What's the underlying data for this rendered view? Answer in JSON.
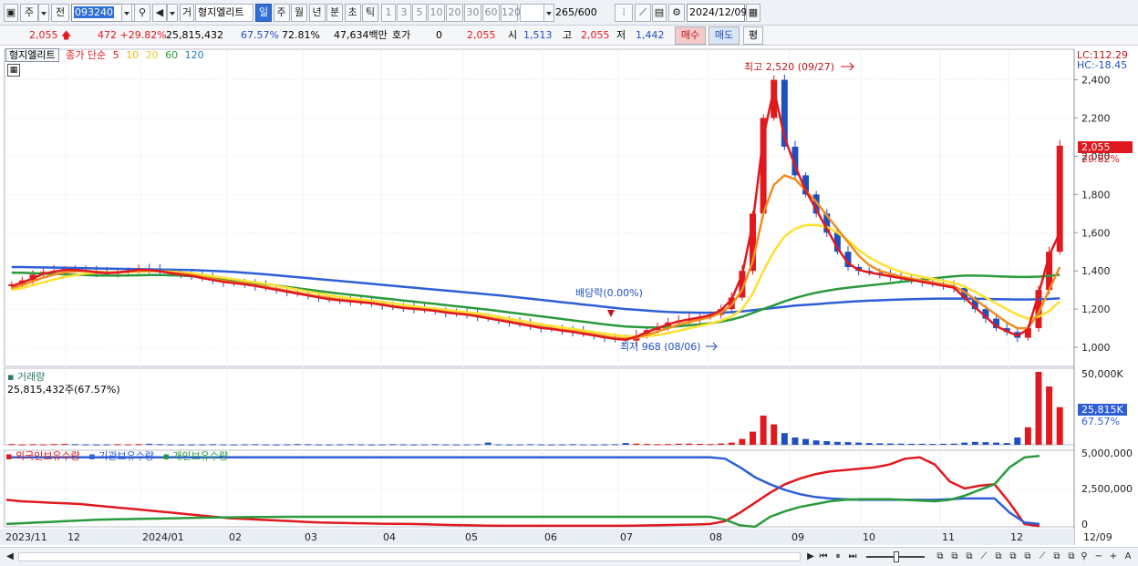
{
  "toolbar": {
    "period_label": "주",
    "prev_label": "전",
    "code": "093240",
    "name_button": "거",
    "stock_name": "형지엘리트",
    "period_tabs": [
      "일",
      "주",
      "월",
      "년",
      "분",
      "초",
      "틱"
    ],
    "active_tab": "일",
    "intervals": [
      "1",
      "3",
      "5",
      "10",
      "20",
      "30",
      "60",
      "120"
    ],
    "count": "265",
    "count_max": "/600",
    "date": "2024/12/09"
  },
  "quote": {
    "price": "2,055",
    "change": "472",
    "change_pct": "+29.82%",
    "volume": "25,815,432",
    "vol_ratio": "67.57%",
    "ratio2": "72.81%",
    "amount": "47,634백만",
    "hoga_label": "호가",
    "hoga_value": "0",
    "hoga_price": "2,055",
    "open_label": "시",
    "open": "1,513",
    "high_label": "고",
    "high": "2,055",
    "low_label": "저",
    "low": "1,442",
    "buy_label": "매수",
    "sell_label": "매도",
    "eval_label": "평"
  },
  "legend": {
    "name": "형지엘리트",
    "ma_label": "종가 단순",
    "ma_periods": [
      "5",
      "10",
      "20",
      "60",
      "120"
    ],
    "volume_label": "거래량",
    "volume_value": "25,815,432주(67.57%)",
    "holdings_labels": [
      "외국인보유수량",
      "기관보유수량",
      "개인보유수량"
    ]
  },
  "colors": {
    "up": "#e0191f",
    "down": "#1f4fbf",
    "ma5": "#e0191f",
    "ma10": "#f08c1e",
    "ma20": "#ffe030",
    "ma60": "#2a9a3c",
    "ma120": "#2f5fd6",
    "foreign": "#e0191f",
    "institution": "#2f5fd6",
    "individual": "#2a9a3c"
  },
  "chart_data": [
    {
      "type": "candlestick",
      "title": "형지엘리트",
      "ylim": [
        900,
        2560
      ],
      "yticks": [
        "1,000",
        "1,200",
        "1,400",
        "1,600",
        "1,800",
        "2,000",
        "2,200",
        "2,400"
      ],
      "xticks": [
        "2023/11",
        "12",
        "2024/01",
        "02",
        "03",
        "04",
        "05",
        "06",
        "07",
        "08",
        "09",
        "10",
        "11",
        "12",
        "12/09"
      ],
      "annotations": {
        "high": "최고 2,520 (09/27)",
        "low": "최저 968 (08/06)",
        "dividend": "배당락(0.00%)",
        "lc": "LC:112.29",
        "hc": "HC:-18.45",
        "last_price": "2,055",
        "last_pct": "29.82%"
      },
      "close": [
        1330,
        1350,
        1380,
        1395,
        1400,
        1410,
        1405,
        1400,
        1390,
        1385,
        1395,
        1400,
        1410,
        1405,
        1395,
        1385,
        1380,
        1375,
        1360,
        1350,
        1340,
        1335,
        1330,
        1320,
        1310,
        1300,
        1290,
        1280,
        1270,
        1260,
        1250,
        1245,
        1240,
        1235,
        1230,
        1220,
        1210,
        1205,
        1200,
        1195,
        1190,
        1180,
        1175,
        1170,
        1160,
        1150,
        1140,
        1130,
        1120,
        1110,
        1100,
        1095,
        1085,
        1080,
        1070,
        1060,
        1050,
        1040,
        1035,
        1060,
        1090,
        1110,
        1130,
        1140,
        1150,
        1160,
        1170,
        1200,
        1260,
        1400,
        1700,
        2200,
        2400,
        2050,
        1900,
        1800,
        1700,
        1600,
        1500,
        1420,
        1400,
        1390,
        1380,
        1370,
        1360,
        1350,
        1340,
        1330,
        1320,
        1310,
        1250,
        1200,
        1150,
        1100,
        1080,
        1050,
        1100,
        1300,
        1500,
        2055
      ],
      "ma": {
        "5": [
          1320,
          1340,
          1360,
          1385,
          1395,
          1405,
          1405,
          1400,
          1392,
          1388,
          1392,
          1398,
          1405,
          1404,
          1398,
          1388,
          1380,
          1374,
          1362,
          1352,
          1342,
          1336,
          1330,
          1321,
          1311,
          1301,
          1291,
          1281,
          1271,
          1261,
          1252,
          1246,
          1241,
          1236,
          1231,
          1222,
          1213,
          1206,
          1201,
          1196,
          1191,
          1182,
          1176,
          1171,
          1162,
          1152,
          1142,
          1132,
          1122,
          1112,
          1102,
          1096,
          1087,
          1081,
          1071,
          1062,
          1052,
          1044,
          1040,
          1055,
          1080,
          1100,
          1120,
          1135,
          1146,
          1156,
          1168,
          1195,
          1250,
          1380,
          1650,
          2100,
          2350,
          2100,
          1950,
          1820,
          1720,
          1620,
          1520,
          1440,
          1405,
          1392,
          1382,
          1372,
          1362,
          1352,
          1342,
          1332,
          1322,
          1312,
          1260,
          1210,
          1160,
          1110,
          1085,
          1060,
          1095,
          1280,
          1480,
          1600
        ],
        "10": [
          1310,
          1325,
          1345,
          1365,
          1380,
          1392,
          1398,
          1400,
          1396,
          1392,
          1392,
          1395,
          1400,
          1401,
          1398,
          1392,
          1385,
          1378,
          1368,
          1358,
          1348,
          1340,
          1334,
          1325,
          1316,
          1306,
          1296,
          1286,
          1276,
          1266,
          1258,
          1250,
          1244,
          1238,
          1232,
          1225,
          1216,
          1209,
          1203,
          1198,
          1192,
          1185,
          1178,
          1172,
          1165,
          1156,
          1146,
          1136,
          1126,
          1116,
          1107,
          1099,
          1091,
          1084,
          1076,
          1067,
          1058,
          1050,
          1045,
          1050,
          1065,
          1082,
          1100,
          1118,
          1132,
          1145,
          1158,
          1180,
          1220,
          1300,
          1450,
          1700,
          1850,
          1900,
          1880,
          1820,
          1760,
          1690,
          1620,
          1550,
          1480,
          1430,
          1400,
          1385,
          1370,
          1360,
          1350,
          1340,
          1330,
          1320,
          1290,
          1250,
          1210,
          1170,
          1130,
          1100,
          1100,
          1180,
          1300,
          1420
        ],
        "20": [
          1300,
          1310,
          1325,
          1340,
          1355,
          1368,
          1378,
          1386,
          1390,
          1392,
          1393,
          1394,
          1396,
          1398,
          1398,
          1396,
          1392,
          1388,
          1380,
          1372,
          1364,
          1356,
          1348,
          1340,
          1332,
          1322,
          1312,
          1302,
          1292,
          1282,
          1272,
          1264,
          1256,
          1250,
          1244,
          1238,
          1230,
          1222,
          1215,
          1208,
          1202,
          1196,
          1190,
          1184,
          1178,
          1170,
          1160,
          1150,
          1140,
          1130,
          1120,
          1112,
          1104,
          1096,
          1088,
          1080,
          1072,
          1064,
          1058,
          1056,
          1058,
          1064,
          1074,
          1086,
          1100,
          1112,
          1124,
          1140,
          1162,
          1200,
          1280,
          1400,
          1500,
          1580,
          1620,
          1640,
          1640,
          1630,
          1600,
          1560,
          1510,
          1470,
          1440,
          1415,
          1395,
          1380,
          1368,
          1358,
          1348,
          1338,
          1318,
          1290,
          1260,
          1230,
          1200,
          1170,
          1150,
          1160,
          1190,
          1240
        ],
        "60": [
          1390,
          1390,
          1388,
          1386,
          1384,
          1382,
          1380,
          1378,
          1376,
          1375,
          1375,
          1376,
          1377,
          1378,
          1378,
          1377,
          1375,
          1372,
          1368,
          1363,
          1357,
          1350,
          1343,
          1336,
          1330,
          1323,
          1316,
          1309,
          1302,
          1295,
          1288,
          1281,
          1275,
          1269,
          1263,
          1257,
          1251,
          1245,
          1239,
          1233,
          1227,
          1221,
          1215,
          1209,
          1203,
          1197,
          1190,
          1183,
          1176,
          1169,
          1162,
          1155,
          1148,
          1141,
          1134,
          1127,
          1120,
          1114,
          1109,
          1106,
          1104,
          1104,
          1106,
          1110,
          1115,
          1120,
          1126,
          1134,
          1145,
          1160,
          1180,
          1200,
          1220,
          1240,
          1258,
          1273,
          1286,
          1296,
          1305,
          1312,
          1318,
          1324,
          1330,
          1336,
          1342,
          1348,
          1354,
          1360,
          1366,
          1372,
          1375,
          1375,
          1374,
          1372,
          1370,
          1368,
          1368,
          1370,
          1374,
          1380
        ],
        "120": [
          1420,
          1420,
          1419,
          1418,
          1417,
          1416,
          1415,
          1414,
          1413,
          1412,
          1411,
          1410,
          1409,
          1408,
          1407,
          1406,
          1405,
          1404,
          1402,
          1400,
          1397,
          1394,
          1390,
          1386,
          1382,
          1377,
          1372,
          1367,
          1362,
          1357,
          1352,
          1347,
          1342,
          1337,
          1332,
          1327,
          1322,
          1317,
          1312,
          1307,
          1302,
          1297,
          1292,
          1287,
          1282,
          1277,
          1272,
          1266,
          1260,
          1254,
          1248,
          1242,
          1236,
          1230,
          1224,
          1218,
          1212,
          1206,
          1200,
          1196,
          1192,
          1188,
          1185,
          1183,
          1182,
          1181,
          1181,
          1182,
          1184,
          1188,
          1194,
          1200,
          1206,
          1212,
          1218,
          1222,
          1226,
          1230,
          1234,
          1238,
          1241,
          1244,
          1246,
          1248,
          1250,
          1252,
          1253,
          1254,
          1255,
          1255,
          1255,
          1254,
          1253,
          1252,
          1251,
          1250,
          1250,
          1251,
          1253,
          1256
        ]
      }
    },
    {
      "type": "bar",
      "title": "거래량",
      "ylim": [
        0,
        50000000
      ],
      "yticks": [
        "50,000K"
      ],
      "last_label": "25,815K",
      "last_pct": "67.57%",
      "values_k": [
        500,
        300,
        400,
        300,
        500,
        600,
        400,
        300,
        200,
        300,
        400,
        300,
        500,
        700,
        400,
        300,
        200,
        200,
        300,
        400,
        300,
        200,
        300,
        400,
        300,
        200,
        300,
        500,
        400,
        300,
        200,
        300,
        400,
        300,
        200,
        300,
        400,
        300,
        200,
        300,
        400,
        300,
        200,
        300,
        400,
        1500,
        300,
        200,
        300,
        400,
        300,
        200,
        300,
        400,
        300,
        200,
        300,
        400,
        1200,
        800,
        600,
        400,
        500,
        700,
        800,
        600,
        500,
        900,
        1500,
        4000,
        9000,
        20000,
        14000,
        8000,
        5000,
        4000,
        3000,
        2500,
        2000,
        1800,
        1500,
        1200,
        1000,
        900,
        800,
        700,
        700,
        600,
        700,
        800,
        1500,
        2000,
        1800,
        1500,
        1200,
        5000,
        12000,
        50000,
        40000,
        25815
      ]
    },
    {
      "type": "line",
      "title": "보유수량",
      "ylim": [
        -200000,
        5200000
      ],
      "yticks": [
        "5,000,000",
        "2,500,000",
        "0"
      ],
      "series": [
        {
          "name": "외국인보유수량",
          "values": [
            1700000,
            1600000,
            1550000,
            1500000,
            1450000,
            1400000,
            1300000,
            1200000,
            1100000,
            1000000,
            900000,
            800000,
            700000,
            600000,
            500000,
            400000,
            350000,
            300000,
            250000,
            200000,
            150000,
            100000,
            80000,
            60000,
            40000,
            20000,
            10000,
            0,
            -20000,
            -50000,
            -80000,
            -100000,
            -120000,
            -130000,
            -130000,
            -130000,
            -130000,
            -130000,
            -130000,
            -130000,
            -130000,
            -130000,
            -120000,
            -100000,
            -80000,
            -60000,
            -40000,
            0,
            200000,
            800000,
            1500000,
            2200000,
            2800000,
            3200000,
            3500000,
            3700000,
            3800000,
            3900000,
            4000000,
            4200000,
            4600000,
            4700000,
            4200000,
            3000000,
            2500000,
            2700000,
            2800000,
            1500000,
            0,
            -150000
          ]
        },
        {
          "name": "기관보유수량",
          "values": [
            4700000,
            4700000,
            4700000,
            4700000,
            4700000,
            4700000,
            4700000,
            4700000,
            4700000,
            4700000,
            4700000,
            4700000,
            4700000,
            4700000,
            4700000,
            4700000,
            4700000,
            4700000,
            4700000,
            4700000,
            4700000,
            4700000,
            4700000,
            4700000,
            4700000,
            4700000,
            4700000,
            4700000,
            4700000,
            4700000,
            4700000,
            4700000,
            4700000,
            4700000,
            4700000,
            4700000,
            4700000,
            4700000,
            4700000,
            4700000,
            4700000,
            4700000,
            4700000,
            4700000,
            4700000,
            4700000,
            4700000,
            4700000,
            4600000,
            4000000,
            3300000,
            2800000,
            2400000,
            2100000,
            1900000,
            1800000,
            1750000,
            1700000,
            1700000,
            1700000,
            1700000,
            1700000,
            1700000,
            1750000,
            1800000,
            1800000,
            1800000,
            800000,
            100000,
            0
          ]
        },
        {
          "name": "개인보유수량",
          "values": [
            0,
            50000,
            100000,
            150000,
            200000,
            250000,
            300000,
            320000,
            340000,
            360000,
            380000,
            400000,
            420000,
            440000,
            460000,
            470000,
            480000,
            490000,
            500000,
            510000,
            510000,
            510000,
            510000,
            510000,
            510000,
            510000,
            510000,
            510000,
            510000,
            510000,
            510000,
            510000,
            510000,
            510000,
            510000,
            510000,
            510000,
            510000,
            510000,
            510000,
            510000,
            510000,
            510000,
            510000,
            510000,
            510000,
            510000,
            510000,
            300000,
            -100000,
            -200000,
            500000,
            900000,
            1200000,
            1400000,
            1600000,
            1700000,
            1750000,
            1750000,
            1750000,
            1700000,
            1650000,
            1600000,
            1700000,
            2000000,
            2400000,
            2800000,
            4000000,
            4700000,
            4800000
          ]
        }
      ]
    }
  ],
  "scroll": {
    "zoom_minus": "−",
    "zoom_plus": "+",
    "font_label": "A"
  }
}
